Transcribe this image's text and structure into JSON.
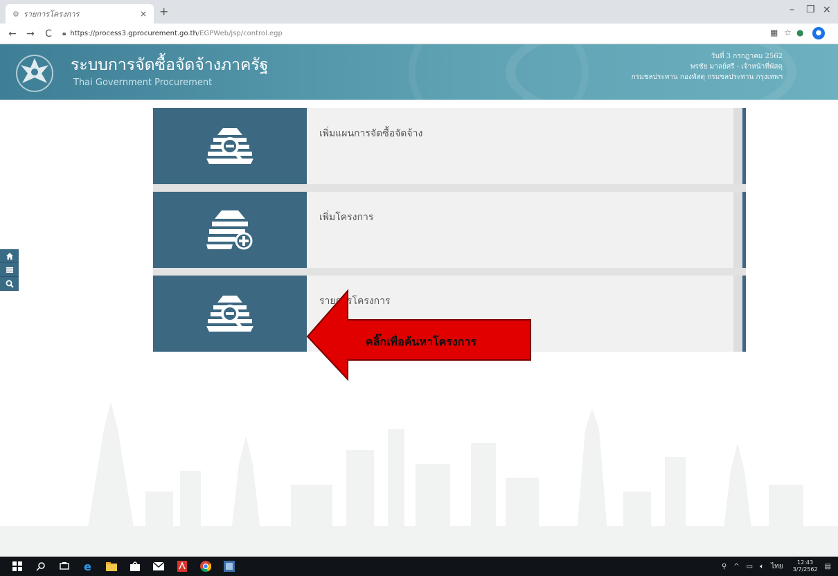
{
  "browser": {
    "tab_title": "รายการโครงการ",
    "tab_close": "×",
    "new_tab": "+",
    "url_host": "https://process3.gprocurement.go.th",
    "url_path": "/EGPWeb/jsp/control.egp",
    "minimize": "–",
    "restore": "❐",
    "close": "×"
  },
  "header": {
    "title": "ระบบการจัดซื้อจัดจ้างภาครัฐ",
    "subtitle": "Thai Government Procurement",
    "date": "วันที่ 3 กรกฎาคม 2562",
    "user": "พรชัย มาลย์ศรี - เจ้าหน้าที่พัสดุ",
    "org": "กรมชลประทาน กองพัสดุ กรมชลประทาน กรุงเทพฯ"
  },
  "cards": [
    {
      "label": "เพิ่มแผนการจัดซื้อจัดจ้าง",
      "icon": "search-stack-icon"
    },
    {
      "label": "เพิ่มโครงการ",
      "icon": "add-stack-icon"
    },
    {
      "label": "รายการโครงการ",
      "icon": "search-stack-icon"
    }
  ],
  "callout": {
    "text": "คลิ๊กเพื่อค้นหาโครงการ",
    "color": "#e00000"
  },
  "sidebar": {
    "items": [
      "home-icon",
      "menu-icon",
      "search-icon"
    ]
  },
  "taskbar": {
    "clock_time": "12:43",
    "clock_date": "3/7/2562",
    "lang": "ไทย"
  },
  "colors": {
    "accent": "#3c6882",
    "header": "#4f90a6"
  }
}
